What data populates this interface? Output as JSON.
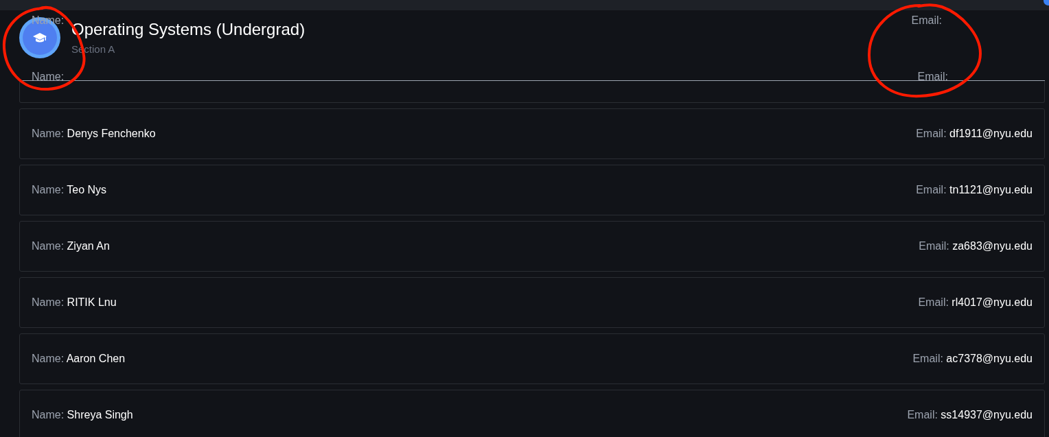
{
  "course": {
    "title": "Operating Systems (Undergrad)",
    "subtitle": "Section A"
  },
  "overlay_labels": [
    {
      "text": "Name:",
      "kind": "name"
    },
    {
      "text": "Email:",
      "kind": "email"
    },
    {
      "text": "Name:",
      "kind": "name"
    },
    {
      "text": "Email:",
      "kind": "email"
    }
  ],
  "students": [
    {
      "name_label": "Name:",
      "name": "Denys Fenchenko",
      "email_label": "Email:",
      "email": "df1911@nyu.edu"
    },
    {
      "name_label": "Name:",
      "name": "Teo Nys",
      "email_label": "Email:",
      "email": "tn1121@nyu.edu"
    },
    {
      "name_label": "Name:",
      "name": "Ziyan An",
      "email_label": "Email:",
      "email": "za683@nyu.edu"
    },
    {
      "name_label": "Name:",
      "name": "RITIK Lnu",
      "email_label": "Email:",
      "email": "rl4017@nyu.edu"
    },
    {
      "name_label": "Name:",
      "name": "Aaron Chen",
      "email_label": "Email:",
      "email": "ac7378@nyu.edu"
    },
    {
      "name_label": "Name:",
      "name": "Shreya Singh",
      "email_label": "Email:",
      "email": "ss14937@nyu.edu"
    }
  ]
}
